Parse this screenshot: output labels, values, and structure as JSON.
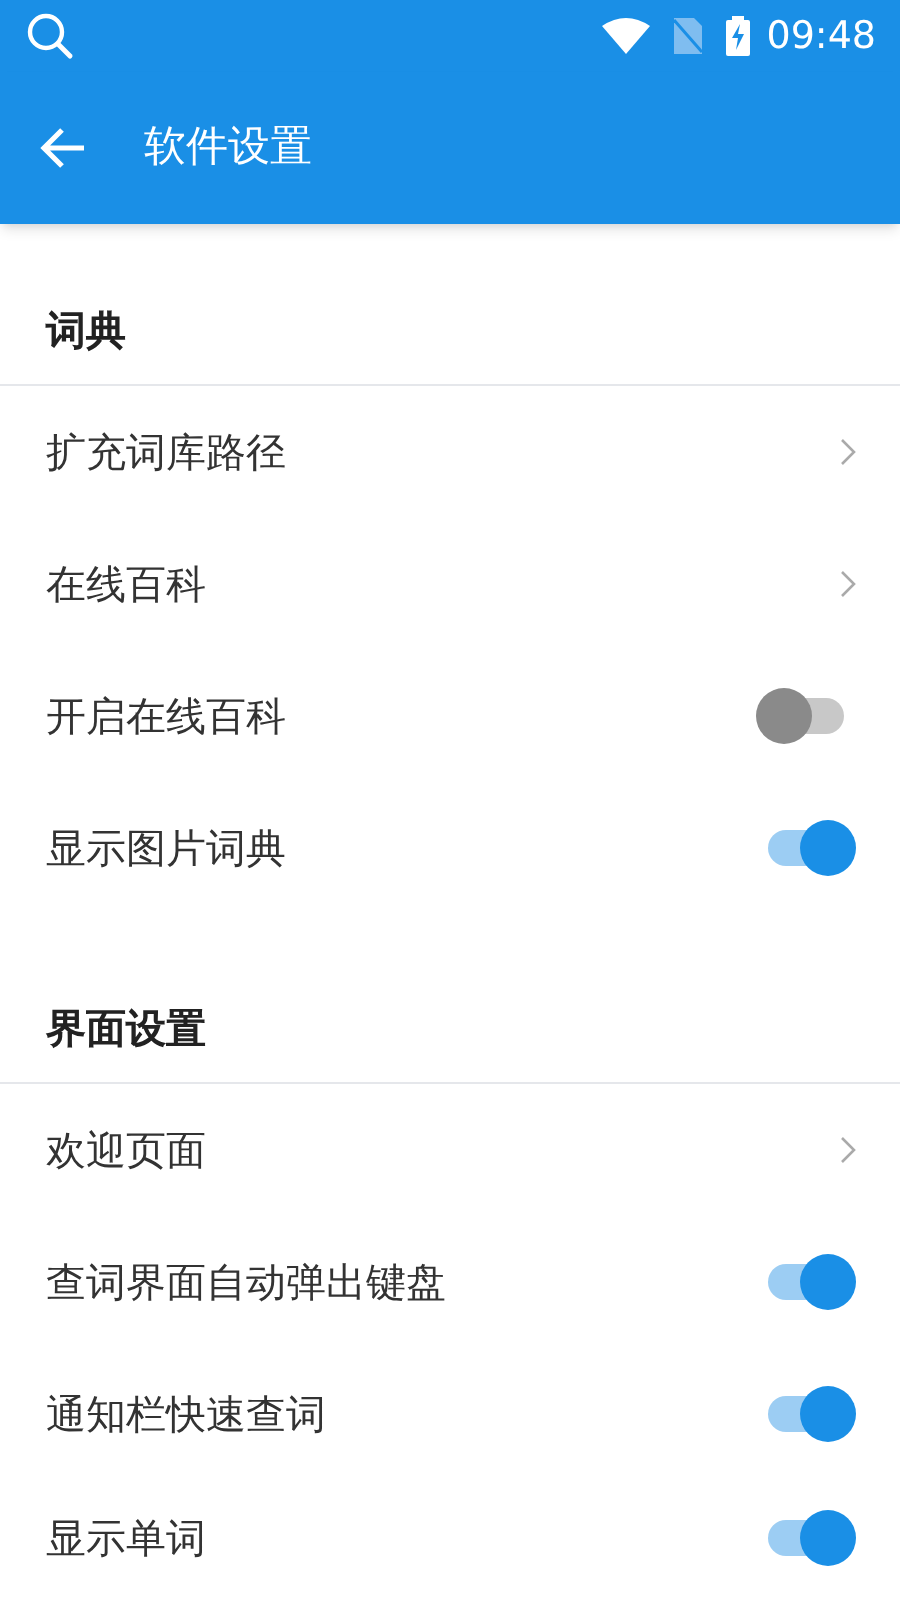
{
  "status_bar": {
    "time": "09:48"
  },
  "app_bar": {
    "title": "软件设置"
  },
  "sections": [
    {
      "title": "词典",
      "items": [
        {
          "kind": "link",
          "label": "扩充词库路径"
        },
        {
          "kind": "link",
          "label": "在线百科"
        },
        {
          "kind": "switch",
          "label": "开启在线百科",
          "on": false
        },
        {
          "kind": "switch",
          "label": "显示图片词典",
          "on": true
        }
      ]
    },
    {
      "title": "界面设置",
      "items": [
        {
          "kind": "link",
          "label": "欢迎页面"
        },
        {
          "kind": "switch",
          "label": "查词界面自动弹出键盘",
          "on": true
        },
        {
          "kind": "switch",
          "label": "通知栏快速查词",
          "on": true
        },
        {
          "kind": "switch",
          "label": "显示单词",
          "on": true
        }
      ]
    }
  ]
}
